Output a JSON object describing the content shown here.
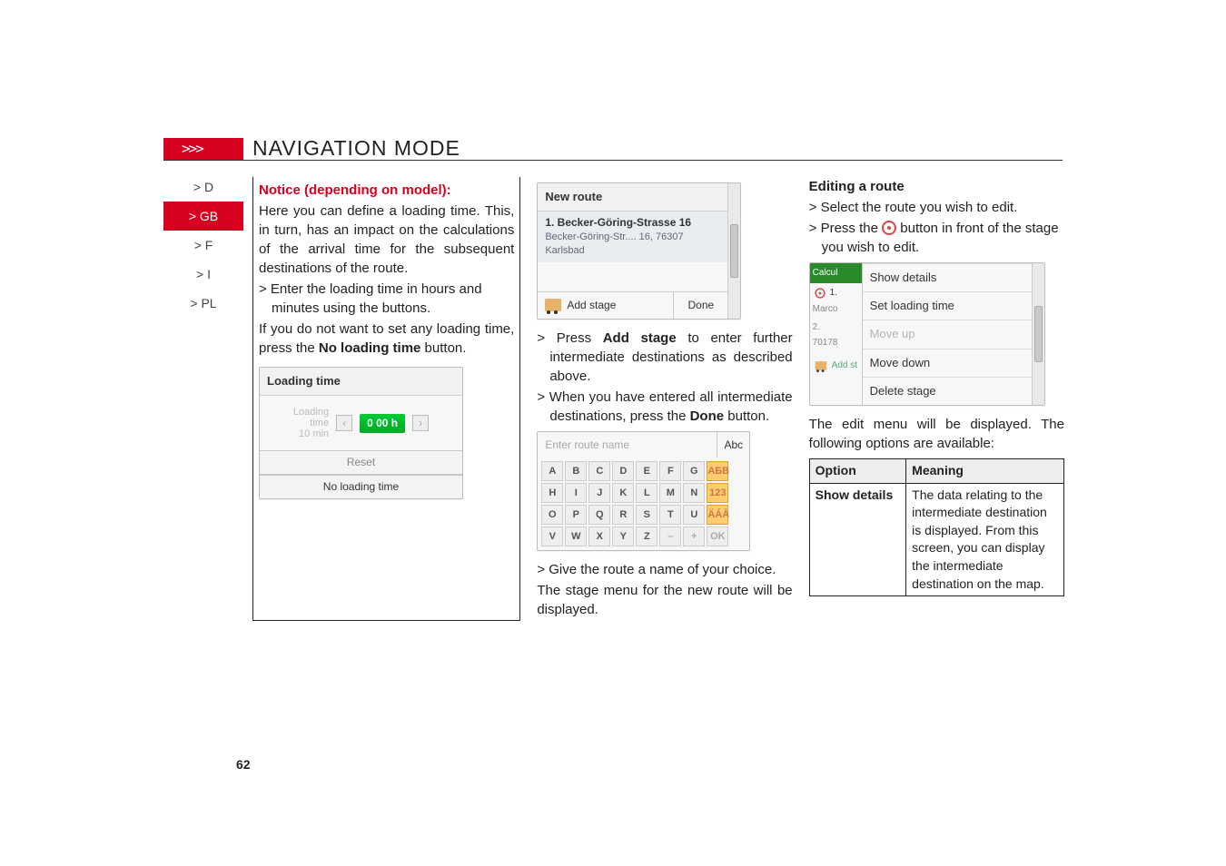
{
  "header": {
    "chevrons": ">>>",
    "title": "NAVIGATION MODE"
  },
  "nav": {
    "items": [
      "> D",
      "> GB",
      "> F",
      "> I",
      "> PL"
    ],
    "active_index": 1
  },
  "col1": {
    "notice_title": "Notice (depending on model):",
    "p1": "Here you can define a loading time. This, in turn, has an impact on the calculations of the arrival time for the subsequent destinations of the route.",
    "b1": "> Enter the loading time in hours and minutes using the buttons.",
    "p2": "If you do not want to set any loading time, press the",
    "p2_bold": "No loading time",
    "p2_tail": " button.",
    "ss_loading": {
      "title": "Loading time",
      "value": "0 00 h",
      "reset": "Reset",
      "noload": "No loading time"
    }
  },
  "col2": {
    "ss_newroute": {
      "title": "New route",
      "line1": "1. Becker-Göring-Strasse 16",
      "line2": "Becker-Göring-Str.... 16, 76307 Karlsbad",
      "add": "Add stage",
      "done": "Done"
    },
    "b1a": "> Press ",
    "b1_bold": "Add stage",
    "b1b": " to enter further intermediate destinations as described above.",
    "b2a": "> When you have entered all intermediate destinations, press the ",
    "b2_bold": "Done",
    "b2b": " button.",
    "ss_kbd": {
      "placeholder": "Enter route name",
      "abc": "Abc",
      "ok": "OK",
      "row1": [
        "A",
        "B",
        "C",
        "D",
        "E",
        "F",
        "G",
        "АБВ"
      ],
      "row2": [
        "H",
        "I",
        "J",
        "K",
        "L",
        "M",
        "N",
        "123"
      ],
      "row3": [
        "O",
        "P",
        "Q",
        "R",
        "S",
        "T",
        "U",
        "ÄÁÀ"
      ],
      "row4": [
        "V",
        "W",
        "X",
        "Y",
        "Z",
        "–",
        "+",
        "OK"
      ]
    },
    "p3": "> Give the route a name of your choice.",
    "p4": "The stage menu for the new route will be displayed."
  },
  "col3": {
    "h": "Editing a route",
    "b1": "> Select the route you wish to edit.",
    "b2a": "> Press the ",
    "b2b": " button in front of the stage you wish to edit.",
    "ss_menu": {
      "left": {
        "top": "Calcul",
        "row1": "1.",
        "row1b": "Marco",
        "row2": "2.",
        "row2b": "70178",
        "addst": "Add st"
      },
      "items": [
        "Show details",
        "Set loading time",
        "Move up",
        "Move down",
        "Delete stage"
      ],
      "disabled_index": 2
    },
    "p5": "The edit menu will be displayed. The following options are available:",
    "table": {
      "h1": "Option",
      "h2": "Meaning",
      "r1c1": "Show details",
      "r1c2": "The data relating to the intermediate destination is displayed. From this screen, you can display the intermediate destination on the map."
    }
  },
  "page_number": "62",
  "chart_data": null
}
